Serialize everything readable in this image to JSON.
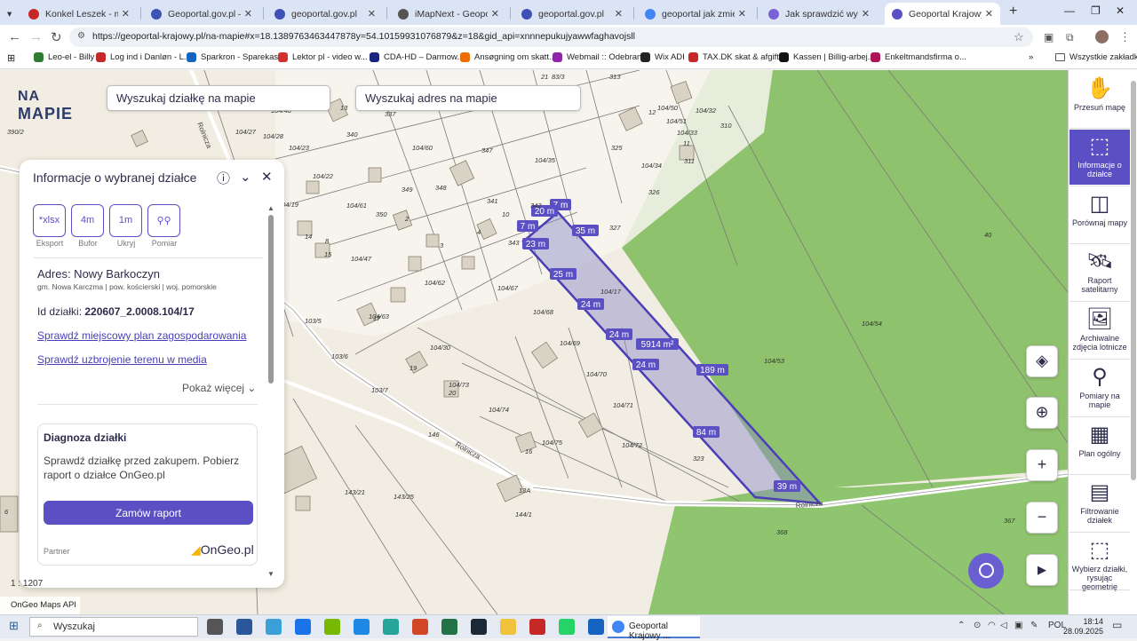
{
  "browser": {
    "tabs": [
      {
        "title": "Konkel Leszek - mieszkan",
        "color": "#c62828"
      },
      {
        "title": "Geoportal.gov.pl – Geopo",
        "color": "#3f51b5"
      },
      {
        "title": "geoportal.gov.pl",
        "color": "#3f51b5"
      },
      {
        "title": "iMapNext - Geoportal",
        "color": "#555555"
      },
      {
        "title": "geoportal.gov.pl",
        "color": "#3f51b5"
      },
      {
        "title": "geoportal jak zmierzyć sz",
        "color": "#4285f4"
      },
      {
        "title": "Jak sprawdzić wymiary dz",
        "color": "#7b61d8"
      },
      {
        "title": "Geoportal Krajowy mapy",
        "color": "#5b4fc4"
      }
    ],
    "url": "https://geoportal-krajowy.pl/na-mapie#x=18.1389763463447878y=54.10159931076879&z=18&gid_api=xnnnepukujyawwfaghavojsll",
    "bookmarks": [
      {
        "label": "Leo-el - Billy",
        "color": "#2e7d32"
      },
      {
        "label": "Log ind i Danløn - L...",
        "color": "#c62828"
      },
      {
        "label": "Sparkron - Sparekas...",
        "color": "#1565c0"
      },
      {
        "label": "Lektor pl - video w...",
        "color": "#d32f2f"
      },
      {
        "label": "CDA-HD – Darmow...",
        "color": "#1a237e"
      },
      {
        "label": "Ansøgning om skatt...",
        "color": "#ef6c00"
      },
      {
        "label": "Webmail :: Odebrane",
        "color": "#8e24aa"
      },
      {
        "label": "Wix ADI",
        "color": "#222222"
      },
      {
        "label": "TAX.DK skat & afgift...",
        "color": "#c62828"
      },
      {
        "label": "Kassen | Billig-arbej...",
        "color": "#111111"
      },
      {
        "label": "Enkeltmandsfirma o...",
        "color": "#ad1457"
      }
    ],
    "all_bookmarks": "Wszystkie zakładki"
  },
  "app": {
    "logo_no": "NA",
    "logo_mapie": "MAPIE",
    "search_parcel": "Wyszukaj działkę na mapie",
    "search_address": "Wyszukaj adres na mapie"
  },
  "panel": {
    "title": "Informacje o wybranej działce",
    "tools": [
      {
        "icon": "*xlsx",
        "label": "Eksport"
      },
      {
        "icon": "4m",
        "label": "Bufor"
      },
      {
        "icon": "1m",
        "label": "Ukryj"
      },
      {
        "icon": "⚲⚲",
        "label": "Pomiar"
      }
    ],
    "address": "Adres: Nowy Barkoczyn",
    "address_sub": "gm. Nowa Karczma | pow. kościerski | woj. pomorskie",
    "id_label": "Id działki:",
    "id_value": "220607_2.0008.104/17",
    "link1": "Sprawdź miejscowy plan zagospodarowania",
    "link2": "Sprawdź uzbrojenie terenu w media",
    "more": "Pokaż więcej",
    "diag_title": "Diagnoza działki",
    "diag_desc": "Sprawdź działkę przed zakupem. Pobierz raport o działce OnGeo.pl",
    "order_btn": "Zamów raport",
    "partner": "Partner",
    "partner_name": "OnGeo.pl"
  },
  "sidebar": [
    {
      "label": "Przesuń mapę",
      "icon": "✋"
    },
    {
      "label": "Informacje o działce",
      "icon": "⬚"
    },
    {
      "label": "Porównaj mapy",
      "icon": "◫"
    },
    {
      "label": "Raport satelitarny",
      "icon": "🛰"
    },
    {
      "label": "Archiwalne zdjęcia lotnicze",
      "icon": "🖼"
    },
    {
      "label": "Pomiary na mapie",
      "icon": "⚲"
    },
    {
      "label": "Plan ogólny",
      "icon": "▦"
    },
    {
      "label": "Filtrowanie działek",
      "icon": "▤"
    },
    {
      "label": "Wybierz działki, rysując geometrię",
      "icon": "⬚"
    }
  ],
  "map": {
    "scale": "1 : 1207",
    "api": "OnGeo Maps API",
    "measures": [
      {
        "text": "7 m"
      },
      {
        "text": "20 m"
      },
      {
        "text": "7 m"
      },
      {
        "text": "35 m"
      },
      {
        "text": "23 m"
      },
      {
        "text": "25 m"
      },
      {
        "text": "24 m"
      },
      {
        "text": "24 m"
      },
      {
        "text": "5914 m²"
      },
      {
        "text": "24 m"
      },
      {
        "text": "189 m"
      },
      {
        "text": "84 m"
      },
      {
        "text": "39 m"
      }
    ],
    "parcel_labels": [
      "390/2",
      "104/48",
      "104/38",
      "104/27",
      "104/28",
      "104/23",
      "104/22",
      "104/60",
      "104/61",
      "104/19",
      "104/47",
      "104/67",
      "104/68",
      "104/69",
      "104/70",
      "104/71",
      "104/72",
      "104/73",
      "104/74",
      "104/75",
      "104/62",
      "104/63",
      "104/30",
      "104/50",
      "104/51",
      "104/34",
      "104/35",
      "104/32",
      "104/33",
      "104/17",
      "104/53",
      "104/54",
      "103/5",
      "103/6",
      "103/7",
      "143/21",
      "143/25",
      "144/1",
      "337",
      "340",
      "347",
      "348",
      "349",
      "350",
      "341",
      "342",
      "343",
      "325",
      "326",
      "327",
      "313",
      "310",
      "311",
      "12",
      "13",
      "14",
      "15",
      "10",
      "11",
      "16",
      "17",
      "19",
      "20",
      "21",
      "2",
      "3",
      "4",
      "6",
      "8",
      "13A",
      "40",
      "368",
      "367",
      "146",
      "83/3",
      "323",
      "104/72"
    ],
    "road_labels": [
      "Rolnicza",
      "Rolnicza",
      "Rolnicza"
    ]
  },
  "taskbar": {
    "search": "Wyszukaj",
    "chrome_label": "Geoportal Krajowy ...",
    "time": "18:14",
    "date": "28.09.2025",
    "lang": "POL"
  }
}
